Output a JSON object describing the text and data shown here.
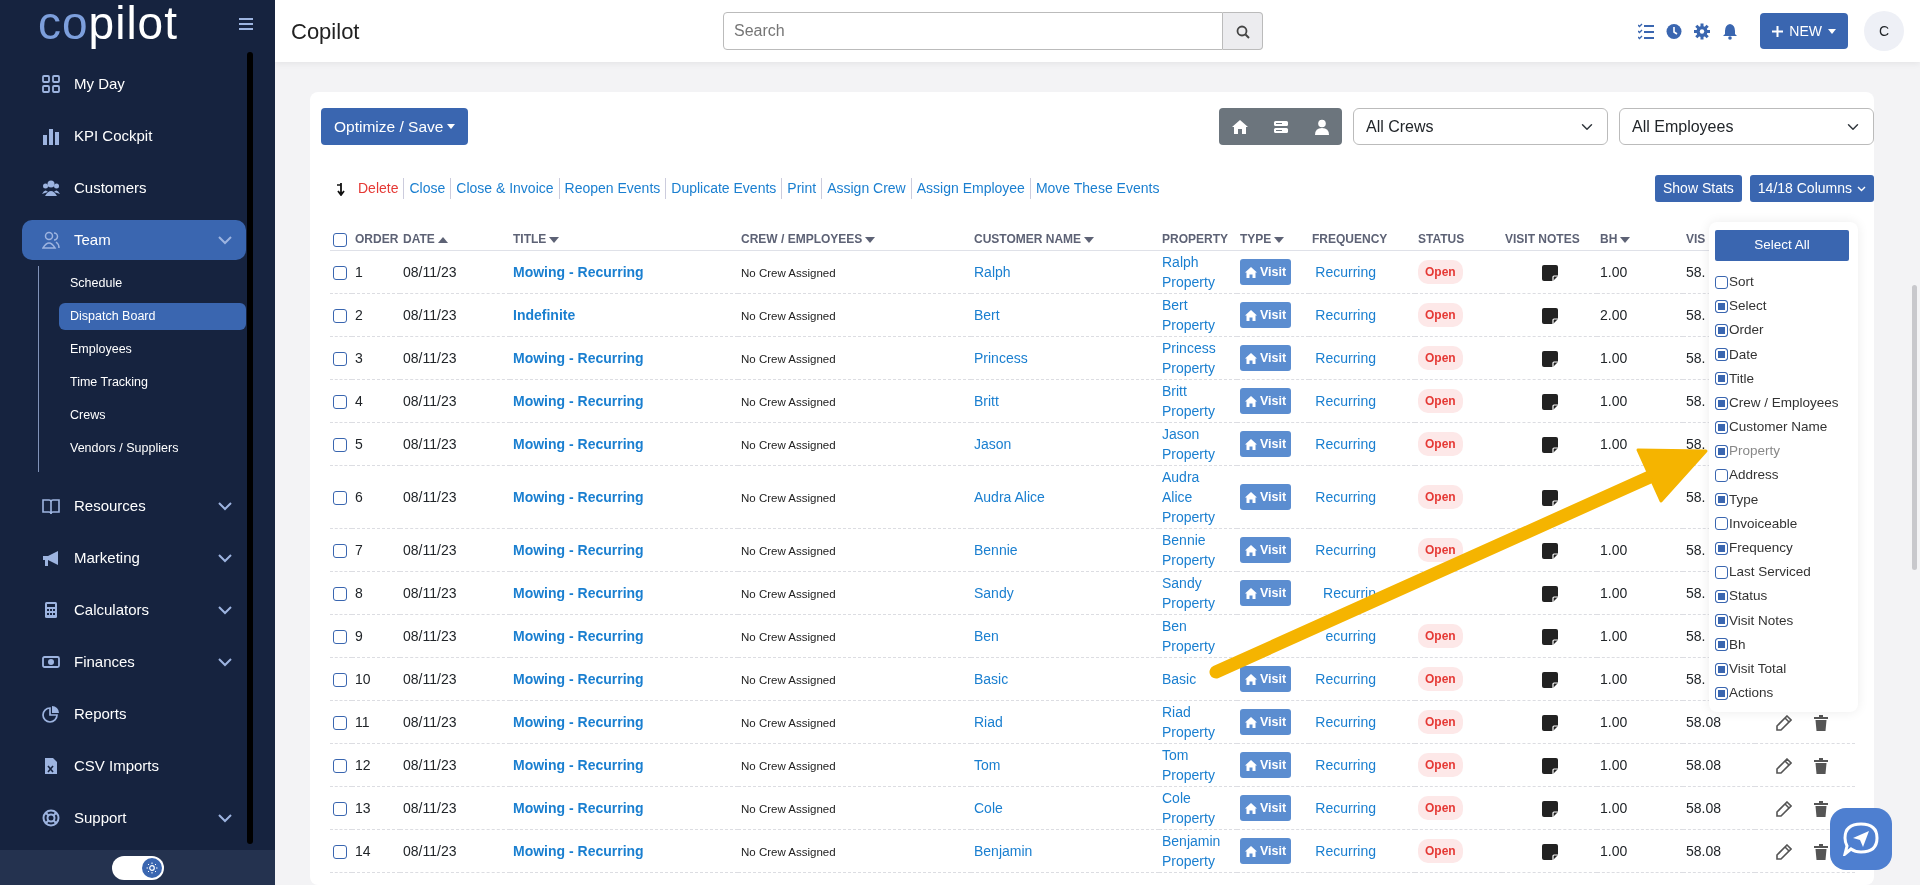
{
  "sidebar": {
    "logo": {
      "part_1": "co",
      "part_2": "pilot"
    },
    "items": [
      {
        "label": "My Day",
        "expandable": false,
        "selected": false
      },
      {
        "label": "KPI Cockpit",
        "expandable": false,
        "selected": false
      },
      {
        "label": "Customers",
        "expandable": false,
        "selected": false
      },
      {
        "label": "Team",
        "expandable": true,
        "expanded": true,
        "selected": true,
        "children": [
          {
            "label": "Schedule",
            "selected": false
          },
          {
            "label": "Dispatch Board",
            "selected": true
          },
          {
            "label": "Employees",
            "selected": false
          },
          {
            "label": "Time Tracking",
            "selected": false
          },
          {
            "label": "Crews",
            "selected": false
          },
          {
            "label": "Vendors / Suppliers",
            "selected": false
          }
        ]
      },
      {
        "label": "Resources",
        "expandable": true,
        "expanded": false,
        "selected": false
      },
      {
        "label": "Marketing",
        "expandable": true,
        "expanded": false,
        "selected": false
      },
      {
        "label": "Calculators",
        "expandable": true,
        "expanded": false,
        "selected": false
      },
      {
        "label": "Finances",
        "expandable": true,
        "expanded": false,
        "selected": false
      },
      {
        "label": "Reports",
        "expandable": false,
        "selected": false
      },
      {
        "label": "CSV Imports",
        "expandable": false,
        "selected": false
      },
      {
        "label": "Support",
        "expandable": true,
        "expanded": false,
        "selected": false
      }
    ],
    "theme_toggle": {
      "on": true
    }
  },
  "header": {
    "title": "Copilot",
    "search": {
      "placeholder": "Search"
    },
    "new_button": "NEW",
    "avatar": "C"
  },
  "toolbar": {
    "optimize_button": "Optimize / Save",
    "crew_filter": "All Crews",
    "employee_filter": "All Employees",
    "actions": [
      {
        "label": "Delete",
        "kind": "danger"
      },
      {
        "label": "Close",
        "kind": "link"
      },
      {
        "label": "Close & Invoice",
        "kind": "link"
      },
      {
        "label": "Reopen Events",
        "kind": "link"
      },
      {
        "label": "Duplicate Events",
        "kind": "link"
      },
      {
        "label": "Print",
        "kind": "link"
      },
      {
        "label": "Assign Crew",
        "kind": "link"
      },
      {
        "label": "Assign Employee",
        "kind": "link"
      },
      {
        "label": "Move These Events",
        "kind": "link"
      }
    ],
    "stats_button": "Show Stats",
    "columns_button": "14/18 Columns"
  },
  "table": {
    "all_selected": false,
    "columns": [
      {
        "label": "ORDER",
        "kind": "plain"
      },
      {
        "label": "DATE",
        "kind": "sort-up"
      },
      {
        "label": "TITLE",
        "kind": "sort-down"
      },
      {
        "label": "CREW / EMPLOYEES",
        "kind": "sort-down"
      },
      {
        "label": "CUSTOMER NAME",
        "kind": "sort-down"
      },
      {
        "label": "PROPERTY",
        "kind": "plain"
      },
      {
        "label": "TYPE",
        "kind": "sort-down"
      },
      {
        "label": "FREQUENCY",
        "kind": "plain"
      },
      {
        "label": "STATUS",
        "kind": "plain"
      },
      {
        "label": "VISIT NOTES",
        "kind": "plain"
      },
      {
        "label": "BH",
        "kind": "sort-down"
      },
      {
        "label": "VIS",
        "kind": "plain"
      }
    ],
    "rows": [
      {
        "selected": false,
        "order": "1",
        "date": "08/11/23",
        "title": "Mowing - Recurring",
        "crew": "No Crew Assigned",
        "customer": "Ralph",
        "property": "Ralph Property",
        "type": "Visit",
        "frequency": "Recurring",
        "status": "Open",
        "bh": "1.00",
        "visit_total": "58.",
        "actions": false
      },
      {
        "selected": false,
        "order": "2",
        "date": "08/11/23",
        "title": "Indefinite",
        "crew": "No Crew Assigned",
        "customer": "Bert",
        "property": "Bert Property",
        "type": "Visit",
        "frequency": "Recurring",
        "status": "Open",
        "bh": "2.00",
        "visit_total": "58.",
        "actions": false
      },
      {
        "selected": false,
        "order": "3",
        "date": "08/11/23",
        "title": "Mowing - Recurring",
        "crew": "No Crew Assigned",
        "customer": "Princess",
        "property": "Princess Property",
        "type": "Visit",
        "frequency": "Recurring",
        "status": "Open",
        "bh": "1.00",
        "visit_total": "58.",
        "actions": false
      },
      {
        "selected": false,
        "order": "4",
        "date": "08/11/23",
        "title": "Mowing - Recurring",
        "crew": "No Crew Assigned",
        "customer": "Britt",
        "property": "Britt Property",
        "type": "Visit",
        "frequency": "Recurring",
        "status": "Open",
        "bh": "1.00",
        "visit_total": "58.",
        "actions": false
      },
      {
        "selected": false,
        "order": "5",
        "date": "08/11/23",
        "title": "Mowing - Recurring",
        "crew": "No Crew Assigned",
        "customer": "Jason",
        "property": "Jason Property",
        "type": "Visit",
        "frequency": "Recurring",
        "status": "Open",
        "bh": "1.00",
        "visit_total": "58.",
        "actions": false
      },
      {
        "selected": false,
        "order": "6",
        "date": "08/11/23",
        "title": "Mowing - Recurring",
        "crew": "No Crew Assigned",
        "customer": "Audra Alice",
        "property": "Audra Alice Property",
        "type": "Visit",
        "frequency": "Recurring",
        "status": "Open",
        "visit_total": "58.",
        "actions": false
      },
      {
        "selected": false,
        "order": "7",
        "date": "08/11/23",
        "title": "Mowing - Recurring",
        "crew": "No Crew Assigned",
        "customer": "Bennie",
        "property": "Bennie Property",
        "type": "Visit",
        "frequency": "Recurring",
        "status": "Open",
        "bh": "1.00",
        "visit_total": "58.",
        "actions": false
      },
      {
        "selected": false,
        "order": "8",
        "date": "08/11/23",
        "title": "Mowing - Recurring",
        "crew": "No Crew Assigned",
        "customer": "Sandy",
        "property": "Sandy Property",
        "type": "Visit",
        "frequency": "Recurrin",
        "bh": "1.00",
        "visit_total": "58.",
        "actions": false
      },
      {
        "selected": false,
        "order": "9",
        "date": "08/11/23",
        "title": "Mowing - Recurring",
        "crew": "No Crew Assigned",
        "customer": "Ben",
        "property": "Ben Property",
        "frequency": "ecurring",
        "status": "Open",
        "bh": "1.00",
        "visit_total": "58.",
        "actions": false
      },
      {
        "selected": false,
        "order": "10",
        "date": "08/11/23",
        "title": "Mowing - Recurring",
        "crew": "No Crew Assigned",
        "customer": "Basic",
        "property": "Basic",
        "type": "Visit",
        "frequency": "Recurring",
        "status": "Open",
        "bh": "1.00",
        "visit_total": "58.",
        "actions": false
      },
      {
        "selected": false,
        "order": "11",
        "date": "08/11/23",
        "title": "Mowing - Recurring",
        "crew": "No Crew Assigned",
        "customer": "Riad",
        "property": "Riad Property",
        "type": "Visit",
        "frequency": "Recurring",
        "status": "Open",
        "bh": "1.00",
        "visit_total": "58.08",
        "actions": true
      },
      {
        "selected": false,
        "order": "12",
        "date": "08/11/23",
        "title": "Mowing - Recurring",
        "crew": "No Crew Assigned",
        "customer": "Tom",
        "property": "Tom Property",
        "type": "Visit",
        "frequency": "Recurring",
        "status": "Open",
        "bh": "1.00",
        "visit_total": "58.08",
        "actions": true
      },
      {
        "selected": false,
        "order": "13",
        "date": "08/11/23",
        "title": "Mowing - Recurring",
        "crew": "No Crew Assigned",
        "customer": "Cole",
        "property": "Cole Property",
        "type": "Visit",
        "frequency": "Recurring",
        "status": "Open",
        "bh": "1.00",
        "visit_total": "58.08",
        "actions": true
      },
      {
        "selected": false,
        "order": "14",
        "date": "08/11/23",
        "title": "Mowing - Recurring",
        "crew": "No Crew Assigned",
        "customer": "Benjamin",
        "property": "Benjamin Property",
        "type": "Visit",
        "frequency": "Recurring",
        "status": "Open",
        "bh": "1.00",
        "visit_total": "58.08",
        "actions": true
      }
    ]
  },
  "column_picker": {
    "select_all": "Select All",
    "items": [
      {
        "label": "Sort",
        "checked": false,
        "disabled": false
      },
      {
        "label": "Select",
        "checked": true,
        "disabled": false
      },
      {
        "label": "Order",
        "checked": true,
        "disabled": false
      },
      {
        "label": "Date",
        "checked": true,
        "disabled": false
      },
      {
        "label": "Title",
        "checked": true,
        "disabled": false
      },
      {
        "label": "Crew / Employees",
        "checked": true,
        "disabled": false
      },
      {
        "label": "Customer Name",
        "checked": true,
        "disabled": false
      },
      {
        "label": "Property",
        "checked": true,
        "disabled": true
      },
      {
        "label": "Address",
        "checked": false,
        "disabled": false
      },
      {
        "label": "Type",
        "checked": true,
        "disabled": false
      },
      {
        "label": "Invoiceable",
        "checked": false,
        "disabled": false
      },
      {
        "label": "Frequency",
        "checked": true,
        "disabled": false
      },
      {
        "label": "Last Serviced",
        "checked": false,
        "disabled": false
      },
      {
        "label": "Status",
        "checked": true,
        "disabled": false
      },
      {
        "label": "Visit Notes",
        "checked": true,
        "disabled": false
      },
      {
        "label": "Bh",
        "checked": true,
        "disabled": false
      },
      {
        "label": "Visit Total",
        "checked": true,
        "disabled": false
      },
      {
        "label": "Actions",
        "checked": true,
        "disabled": false
      }
    ]
  }
}
